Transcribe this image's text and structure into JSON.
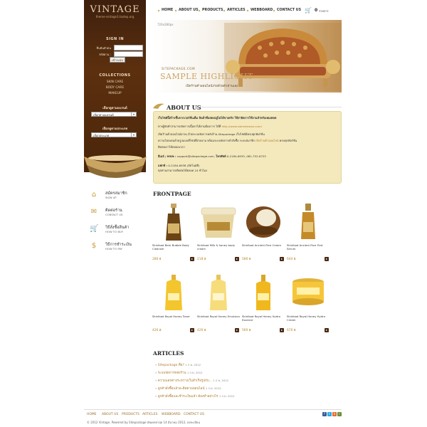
{
  "brand": {
    "title": "VINTAGE",
    "subtitle": "theme-vintage3.tastep.org"
  },
  "nav": [
    "HOME",
    "ABOUT US",
    "PRODUCTS",
    "ARTICLES",
    "WEBBOARD",
    "CONTACT US"
  ],
  "cart": {
    "count": "0",
    "label": "รายการ"
  },
  "sidebar": {
    "signin": "SIGN IN",
    "username_label": "ยืนยันตัวตน",
    "password_label": "รหัสผ่าน :",
    "login_button": "เข้าระบบ",
    "collections_title": "COLLECTIONS",
    "collections": [
      "SKIN CARE",
      "BODY CARE",
      "MAKEUP"
    ],
    "select1_title": "เลือกดูตามแบรนด์",
    "select1_value": "เลือกตามแบรนด์",
    "select2_title": "เลือกดูตามประเภท",
    "select2_value": "เลือกประเภท",
    "links": [
      {
        "title": "สมัครสมาชิก",
        "sub": "SIGN UP",
        "icon": "home-icon"
      },
      {
        "title": "ติดต่อร้าน",
        "sub": "CONTACT US",
        "icon": "envelope-icon"
      },
      {
        "title": "วิธีสั่งซื้อสินค้า",
        "sub": "HOW TO BUY",
        "icon": "cart-icon"
      },
      {
        "title": "วิธีการชำระเงิน",
        "sub": "HOW TO PAY",
        "icon": "dollar-icon"
      }
    ]
  },
  "banner": {
    "size_label": "720x280px",
    "small": "SITEPACKAGE.COM",
    "title": "SAMPLE HIGHLIGHT",
    "subtitle": "เปิดร้านค้าออนไลน์ง่ายด้วยตัวท่านเอง"
  },
  "about": {
    "title": "ABOUT US",
    "p1": "เว็บไซต์นี้สร้างขึ้นจากเวอร์ชั่นเต็ม สินค้าที่แสดงอยู่ไม่ได้ขายจริง ใช้สาธิตการใช้งานสำหรับเทมเพลต",
    "p2a": "ทางผู้จัดทำสามารถจัดการเนื้อหาได้ตามต้องการ ได้ที่",
    "p2b": "http://www.siamdrowse.com/",
    "p3": "เปิดร้านค้าออนไลน์ง่ายๆ ด้วยระบบจัดการหลังร้าน Sitepackage เว็บไซต์มีครบทุกฟังก์ชั่น",
    "p4": "ความโดดเด่นด้วยรูปแบบดีไซน์ที่สวยงาม พร้อมระบบจัดการคำสั่งซื้อ ระบบสมาชิก",
    "p4b": "เปิดร้านค้าออนไลน์",
    "p4c": "ครบทุกฟังก์ชั่น",
    "p5": "ติดต่อเราได้ตลอดเวลา",
    "p6a": "อีเมล์ / MSN :",
    "p6b": "support@sitepackage.com,",
    "p6c": "โทรศัพท์",
    "p6d": "0-2184-6935, 081-752-8725",
    "p7a": "แฟกซ์ :",
    "p7b": "0-2184-6938 (อัตโนมัติ)",
    "p8": "ทุกท่านสามารถติดต่อได้ตลอด 24 ชั่วโมง"
  },
  "frontpage": {
    "title": "FRONTPAGE",
    "products": [
      {
        "name": "Skinfood Beer Bubble Body Cleanser",
        "price": "286 ฿"
      },
      {
        "name": "Skinfood Milk & honey body cream",
        "price": "218 ฿"
      },
      {
        "name": "Skinfood Ancient Rice Cream",
        "price": "580 ฿"
      },
      {
        "name": "Skinfood Ancient Rice First Serum",
        "price": "644 ฿"
      },
      {
        "name": "Skinfood Royal Honey Toner",
        "price": "426 ฿"
      },
      {
        "name": "Skinfood Royal Honey Emulsion",
        "price": "426 ฿"
      },
      {
        "name": "Skinfood Royal Honey Hydro Essence",
        "price": "560 ฿"
      },
      {
        "name": "Skinfood Royal Honey Hydro Cream",
        "price": "676 ฿"
      }
    ]
  },
  "articles": {
    "title": "ARTICLES",
    "items": [
      {
        "title": "Sitepackage คือ?",
        "date": "1 ก.พ. 2012"
      },
      {
        "title": "ระบบจัดการหลังร้าน",
        "date": "1 ก.พ. 2012"
      },
      {
        "title": "ความแตกต่างระหว่างเว็บสำเร็จรูปกับ...",
        "date": "1 ก.พ. 2012"
      },
      {
        "title": "ลูกค้าสั่งซื้อแล้วจะติดตามออนไลน์",
        "date": "1 ก.พ. 2012"
      },
      {
        "title": "ลูกค้าสั่งซื้อและชำระเงินแล้ว ต้องทำอย่างไร",
        "date": "1 ก.พ. 2012"
      }
    ]
  },
  "footer": {
    "links": [
      "HOME",
      "ABOUT US",
      "PRODUCTS",
      "ARTICLES",
      "WEBBOARD",
      "CONTACT US"
    ],
    "copyright": "© 2012 Vintage. Powered by Sitepackage อัพเดทล่าสุด 14 มีนาคม 2012, ลงทะเบียน",
    "social": [
      "f",
      "t",
      "b",
      "r"
    ]
  },
  "colors": {
    "accent": "#c7a34d",
    "brown": "#4a2509",
    "about_bg": "#f4e9bd",
    "link": "#b07b2a"
  }
}
